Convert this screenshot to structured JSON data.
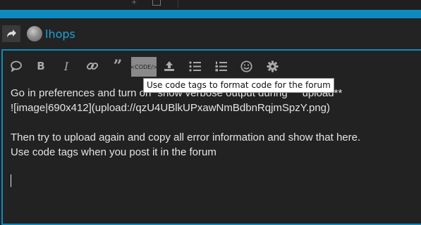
{
  "header": {
    "username": "lhops"
  },
  "toolbar": {
    "buttons": [
      {
        "name": "quote-bubble-icon"
      },
      {
        "name": "bold-icon",
        "label": "B"
      },
      {
        "name": "italic-icon",
        "label": "I"
      },
      {
        "name": "link-icon"
      },
      {
        "name": "blockquote-icon"
      },
      {
        "name": "code-button",
        "label": "<CODE/>"
      },
      {
        "name": "upload-icon"
      },
      {
        "name": "bullet-list-icon"
      },
      {
        "name": "numbered-list-icon"
      },
      {
        "name": "emoji-icon"
      },
      {
        "name": "gear-icon"
      }
    ],
    "tooltip": "Use code tags to format code for the forum"
  },
  "editor": {
    "lines": [
      "Go in preferences and turn on “show verbose output during” **upload**",
      "![image|690x412](upload://qzU4UBlkUPxawNmBdbnRqjmSpzY.png)",
      "",
      "Then try to upload again and copy all error information and show that here.",
      "Use code tags when you post it in the forum"
    ]
  },
  "colors": {
    "accent": "#0e8ac0",
    "username": "#1ea0d8",
    "background": "#222222",
    "text": "#e4e4e4"
  }
}
